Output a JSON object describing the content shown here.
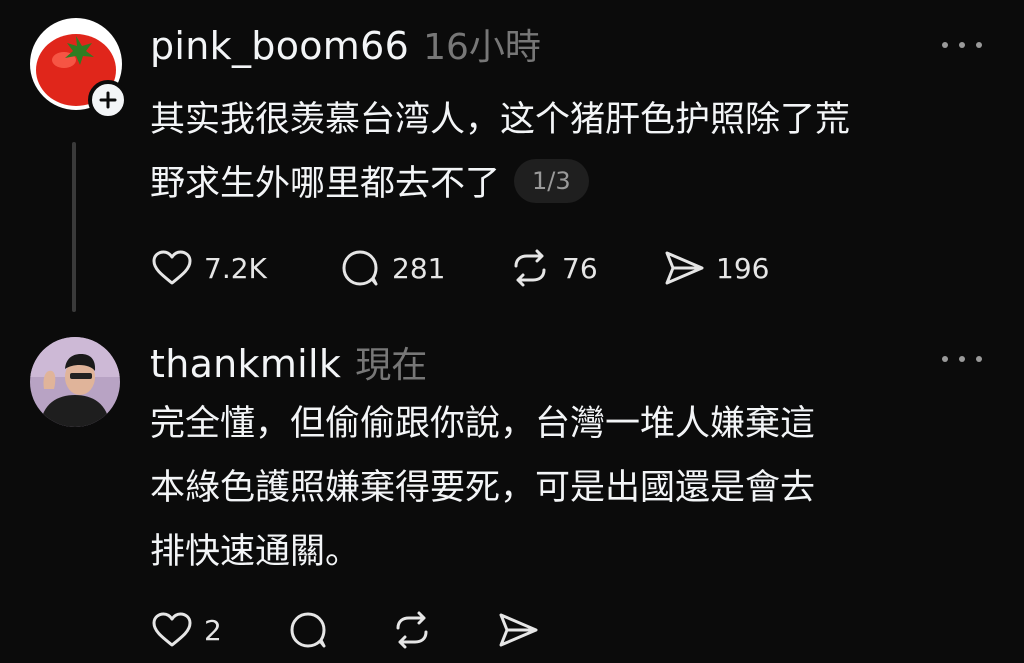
{
  "posts": [
    {
      "username": "pink_boom66",
      "timestamp": "16小時",
      "text_lines": [
        "其实我很羡慕台湾人，这个猪肝色护照除了荒",
        "野求生外哪里都去不了"
      ],
      "page_indicator": "1/3",
      "likes": "7.2K",
      "comments": "281",
      "reposts": "76",
      "shares": "196",
      "avatar_icon": "tomato-avatar",
      "has_follow_badge": true
    },
    {
      "username": "thankmilk",
      "timestamp": "現在",
      "text_lines": [
        "完全懂，但偷偷跟你說，台灣一堆人嫌棄這",
        "本綠色護照嫌棄得要死，可是出國還是會去",
        "排快速通關。"
      ],
      "likes": "2",
      "avatar_icon": "person-avatar"
    }
  ],
  "colors": {
    "background": "#0b0b0b",
    "text": "#f3f5f7",
    "muted": "#777777",
    "thread_line": "#3a3a3a"
  }
}
